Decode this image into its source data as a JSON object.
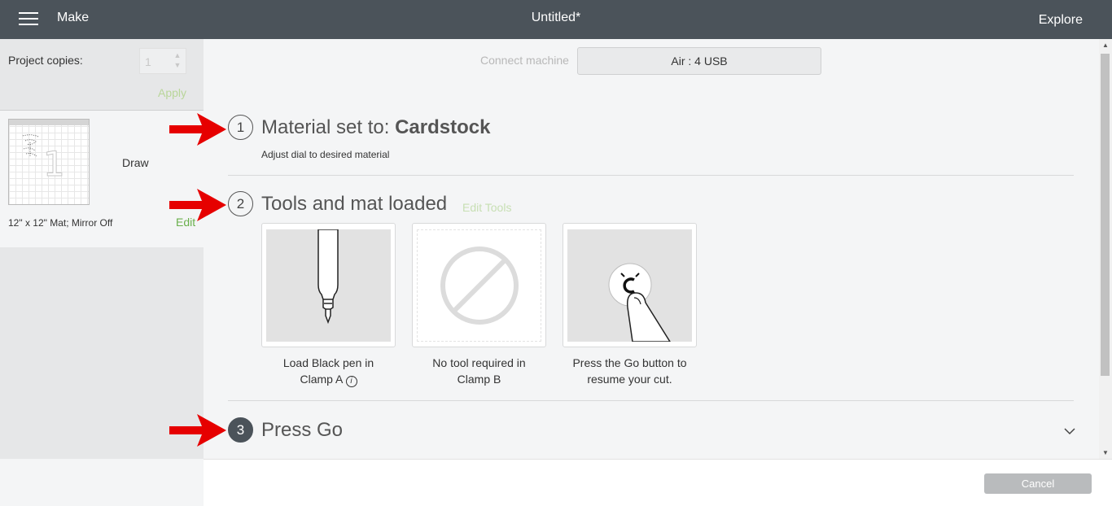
{
  "header": {
    "menu_icon": "hamburger-menu-icon",
    "app_label": "Make",
    "document_title": "Untitled*",
    "explore_label": "Explore"
  },
  "sidebar": {
    "copies_label": "Project copies:",
    "copies_value": "1",
    "apply_label": "Apply",
    "mat": {
      "number": "1",
      "operation_label": "Draw",
      "description": "12\" x 12\" Mat; Mirror Off",
      "edit_label": "Edit"
    }
  },
  "main": {
    "connect_label": "Connect machine",
    "machine_value": "Air : 4 USB",
    "steps": [
      {
        "number": "1",
        "title_prefix": "Material set to: ",
        "title_bold": "Cardstock",
        "note": "Adjust dial to desired material"
      },
      {
        "number": "2",
        "title": "Tools and mat loaded",
        "edit_tools_label": "Edit Tools"
      },
      {
        "number": "3",
        "title": "Press Go"
      }
    ],
    "tools": [
      {
        "caption_line1": "Load Black pen in",
        "caption_line2": "Clamp A",
        "icon": "pen-icon",
        "info_icon": "info-icon",
        "info_glyph": "i"
      },
      {
        "caption_line1": "No tool required in",
        "caption_line2": "Clamp B",
        "icon": "no-tool-icon"
      },
      {
        "caption_line1": "Press the Go button to",
        "caption_line2": "resume your cut.",
        "icon": "press-go-button-icon"
      }
    ]
  },
  "footer": {
    "cancel_label": "Cancel"
  },
  "colors": {
    "header_bg": "#4b535a",
    "accent_green": "#6ab04c",
    "arrow_red": "#e60000",
    "cancel_bg": "#b9bbbd"
  }
}
